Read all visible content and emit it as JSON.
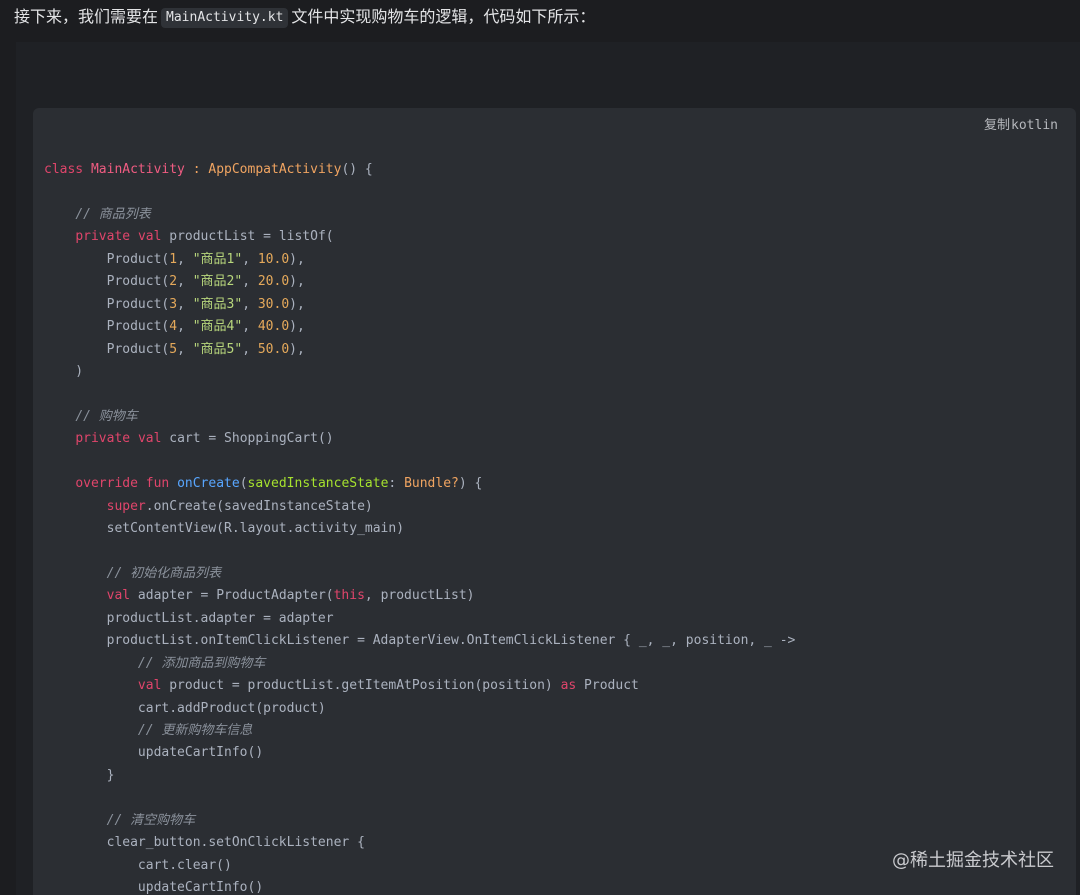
{
  "intro": {
    "before": "接下来，我们需要在",
    "code": "MainActivity.kt",
    "after": "文件中实现购物车的逻辑，代码如下所示："
  },
  "code_block": {
    "copy_label": "复制",
    "language": "kotlin",
    "lines": [
      [
        {
          "t": "class",
          "c": "kw"
        },
        {
          "t": " "
        },
        {
          "t": "MainActivity",
          "c": "cls"
        },
        {
          "t": " : ",
          "c": "ty"
        },
        {
          "t": "AppCompatActivity",
          "c": "ty"
        },
        {
          "t": "() {"
        }
      ],
      [],
      [
        {
          "t": "    "
        },
        {
          "t": "// 商品列表",
          "c": "cm"
        }
      ],
      [
        {
          "t": "    "
        },
        {
          "t": "private",
          "c": "kw"
        },
        {
          "t": " "
        },
        {
          "t": "val",
          "c": "kw"
        },
        {
          "t": " productList = listOf("
        }
      ],
      [
        {
          "t": "        Product("
        },
        {
          "t": "1",
          "c": "num"
        },
        {
          "t": ", "
        },
        {
          "t": "\"商品1\"",
          "c": "str"
        },
        {
          "t": ", "
        },
        {
          "t": "10.0",
          "c": "num"
        },
        {
          "t": "),"
        }
      ],
      [
        {
          "t": "        Product("
        },
        {
          "t": "2",
          "c": "num"
        },
        {
          "t": ", "
        },
        {
          "t": "\"商品2\"",
          "c": "str"
        },
        {
          "t": ", "
        },
        {
          "t": "20.0",
          "c": "num"
        },
        {
          "t": "),"
        }
      ],
      [
        {
          "t": "        Product("
        },
        {
          "t": "3",
          "c": "num"
        },
        {
          "t": ", "
        },
        {
          "t": "\"商品3\"",
          "c": "str"
        },
        {
          "t": ", "
        },
        {
          "t": "30.0",
          "c": "num"
        },
        {
          "t": "),"
        }
      ],
      [
        {
          "t": "        Product("
        },
        {
          "t": "4",
          "c": "num"
        },
        {
          "t": ", "
        },
        {
          "t": "\"商品4\"",
          "c": "str"
        },
        {
          "t": ", "
        },
        {
          "t": "40.0",
          "c": "num"
        },
        {
          "t": "),"
        }
      ],
      [
        {
          "t": "        Product("
        },
        {
          "t": "5",
          "c": "num"
        },
        {
          "t": ", "
        },
        {
          "t": "\"商品5\"",
          "c": "str"
        },
        {
          "t": ", "
        },
        {
          "t": "50.0",
          "c": "num"
        },
        {
          "t": "),"
        }
      ],
      [
        {
          "t": "    )"
        }
      ],
      [],
      [
        {
          "t": "    "
        },
        {
          "t": "// 购物车",
          "c": "cm"
        }
      ],
      [
        {
          "t": "    "
        },
        {
          "t": "private",
          "c": "kw"
        },
        {
          "t": " "
        },
        {
          "t": "val",
          "c": "kw"
        },
        {
          "t": " cart = ShoppingCart()"
        }
      ],
      [],
      [
        {
          "t": "    "
        },
        {
          "t": "override",
          "c": "kw"
        },
        {
          "t": " "
        },
        {
          "t": "fun",
          "c": "kw"
        },
        {
          "t": " "
        },
        {
          "t": "onCreate",
          "c": "fn"
        },
        {
          "t": "("
        },
        {
          "t": "savedInstanceState",
          "c": "pm"
        },
        {
          "t": ": "
        },
        {
          "t": "Bundle?",
          "c": "ty"
        },
        {
          "t": ") {"
        }
      ],
      [
        {
          "t": "        "
        },
        {
          "t": "super",
          "c": "kw"
        },
        {
          "t": ".onCreate(savedInstanceState)"
        }
      ],
      [
        {
          "t": "        setContentView(R.layout.activity_main)"
        }
      ],
      [],
      [
        {
          "t": "        "
        },
        {
          "t": "// 初始化商品列表",
          "c": "cm"
        }
      ],
      [
        {
          "t": "        "
        },
        {
          "t": "val",
          "c": "kw"
        },
        {
          "t": " adapter = ProductAdapter("
        },
        {
          "t": "this",
          "c": "kw"
        },
        {
          "t": ", productList)"
        }
      ],
      [
        {
          "t": "        productList.adapter = adapter"
        }
      ],
      [
        {
          "t": "        productList.onItemClickListener = AdapterView.OnItemClickListener { _, _, position, _ ->"
        }
      ],
      [
        {
          "t": "            "
        },
        {
          "t": "// 添加商品到购物车",
          "c": "cm"
        }
      ],
      [
        {
          "t": "            "
        },
        {
          "t": "val",
          "c": "kw"
        },
        {
          "t": " product = productList.getItemAtPosition(position) "
        },
        {
          "t": "as",
          "c": "kw"
        },
        {
          "t": " Product"
        }
      ],
      [
        {
          "t": "            cart.addProduct(product)"
        }
      ],
      [
        {
          "t": "            "
        },
        {
          "t": "// 更新购物车信息",
          "c": "cm"
        }
      ],
      [
        {
          "t": "            updateCartInfo()"
        }
      ],
      [
        {
          "t": "        }"
        }
      ],
      [],
      [
        {
          "t": "        "
        },
        {
          "t": "// 清空购物车",
          "c": "cm"
        }
      ],
      [
        {
          "t": "        clear_button.setOnClickListener {"
        }
      ],
      [
        {
          "t": "            cart.clear()"
        }
      ],
      [
        {
          "t": "            updateCartInfo()"
        }
      ]
    ]
  },
  "watermark": "@稀土掘金技术社区"
}
